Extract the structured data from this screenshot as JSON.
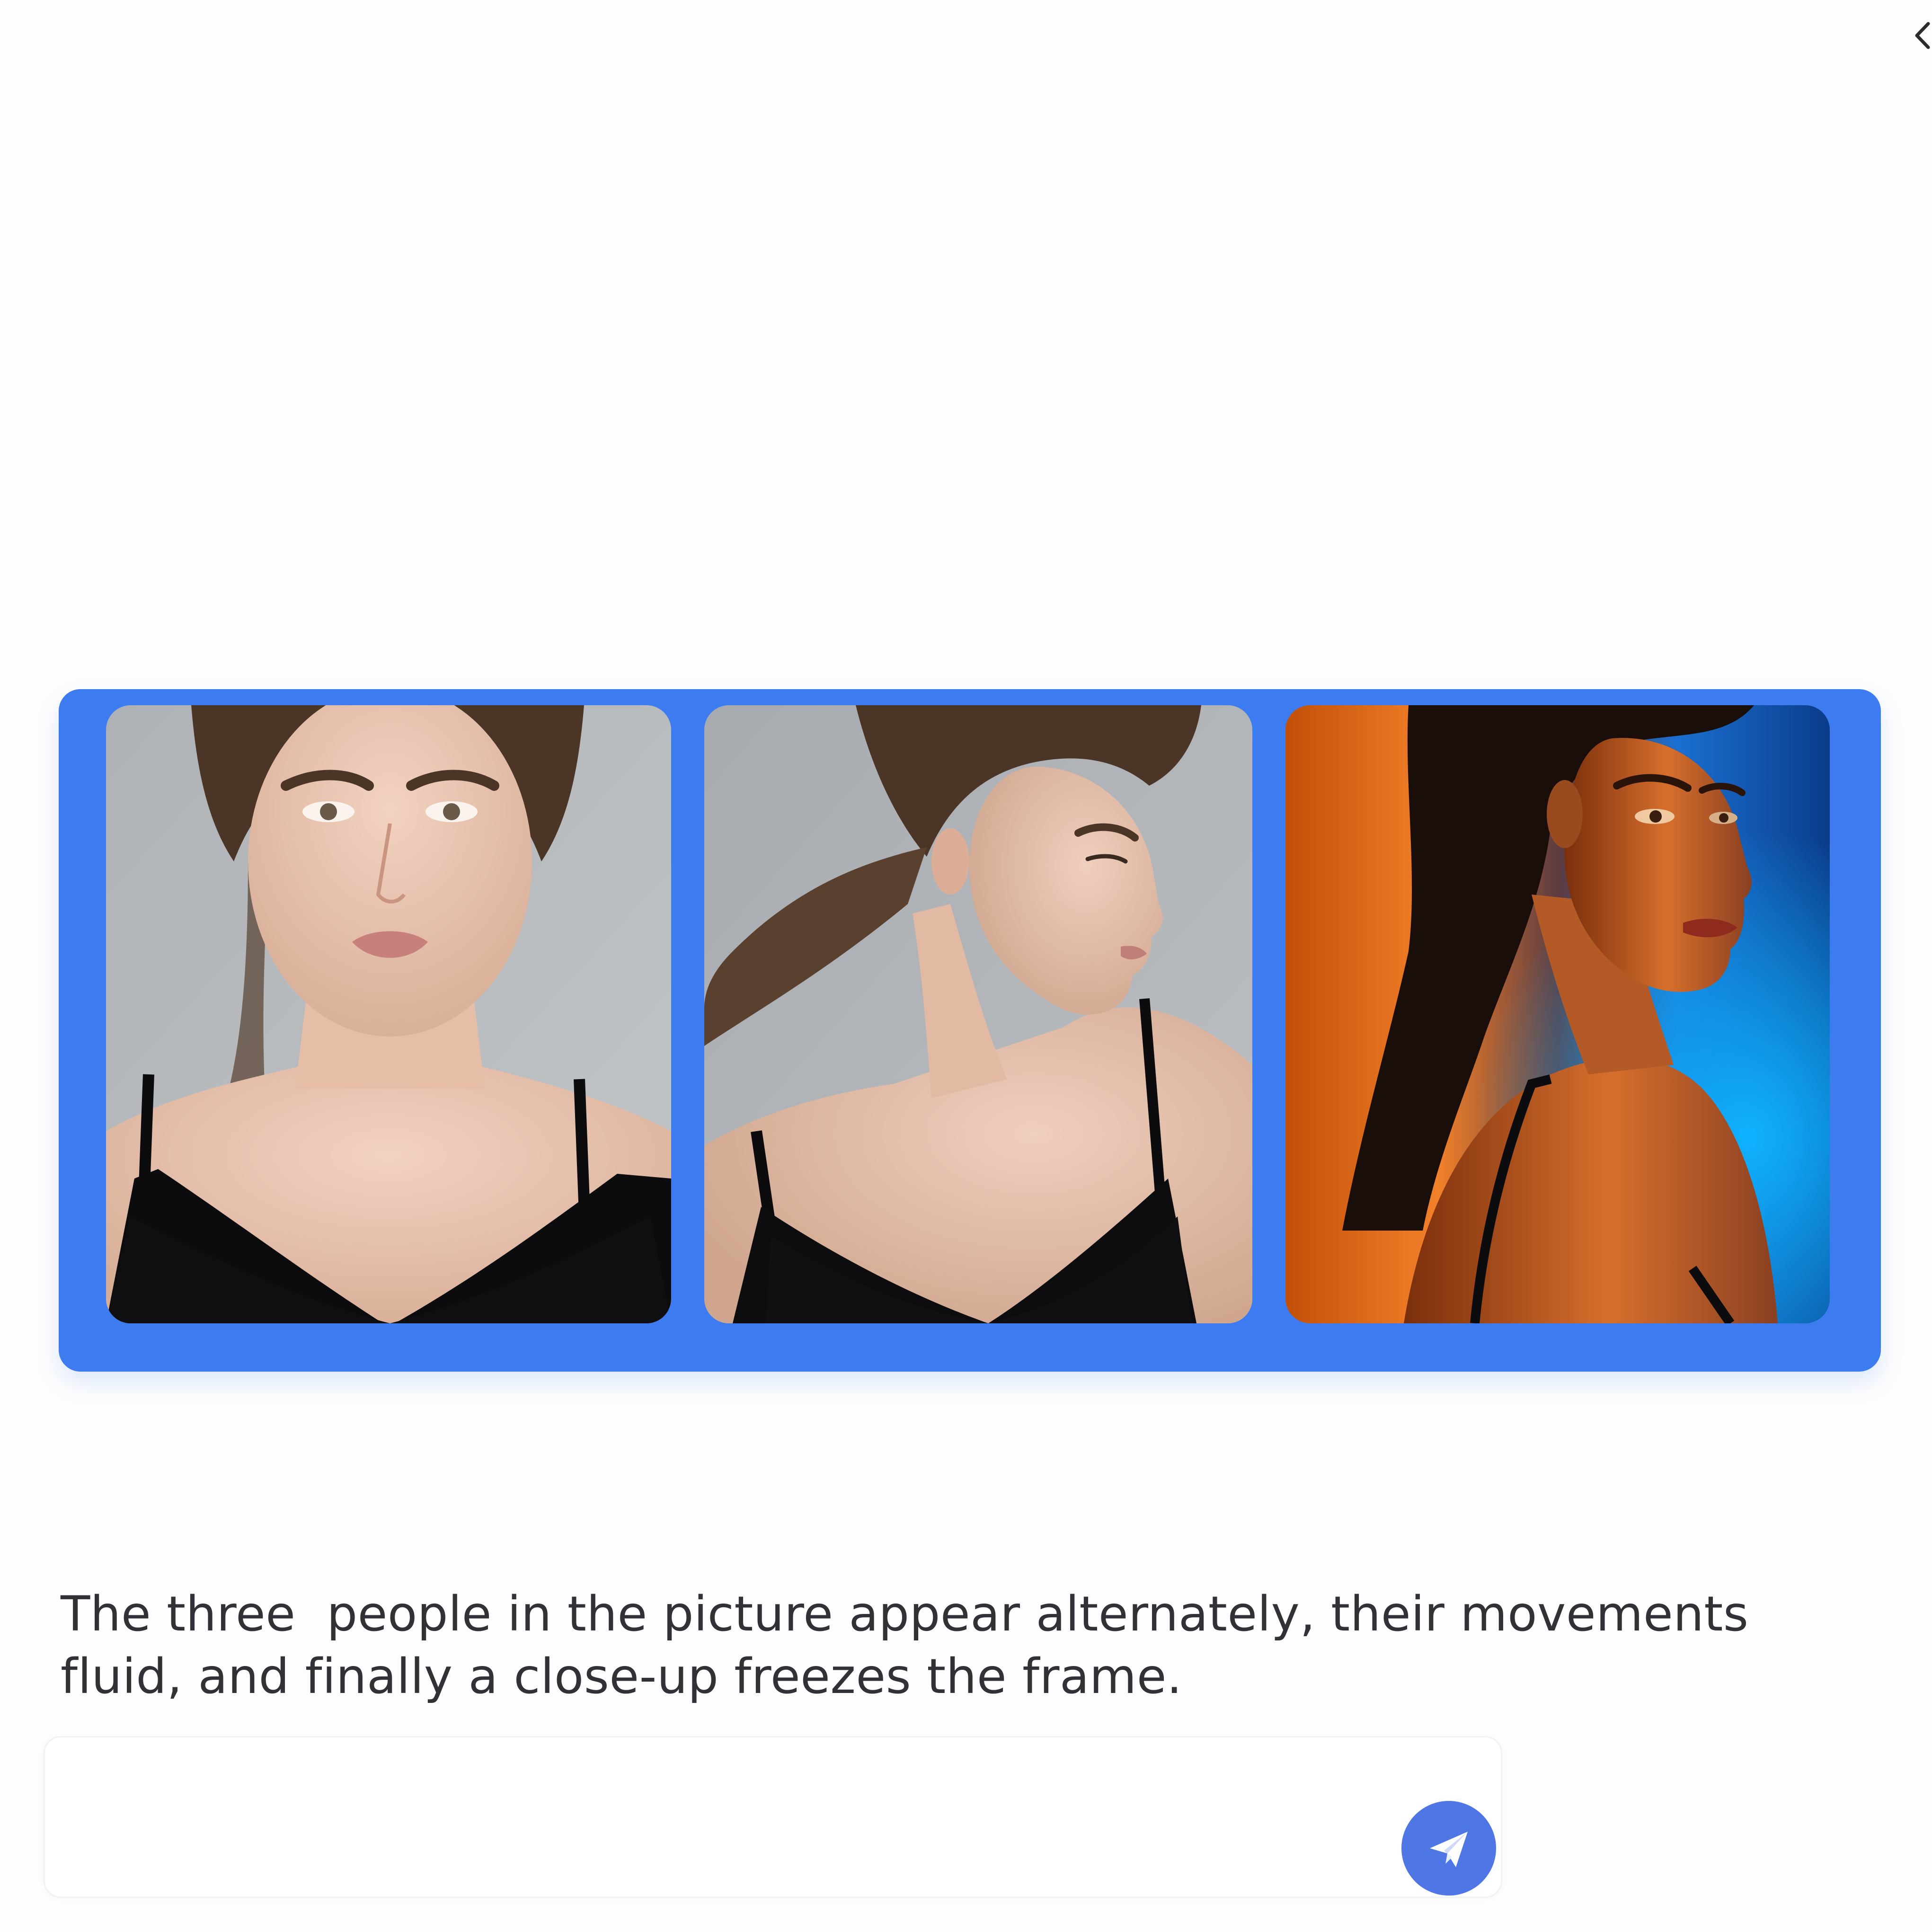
{
  "caption": {
    "line1": "The three  people in the picture appear alternately, their movements",
    "line2": "fluid, and finally a close-up freezes the frame."
  },
  "prompt": {
    "value": "",
    "placeholder": ""
  },
  "icons": {
    "collapse": "chevron-left-icon",
    "send": "paper-plane-icon"
  },
  "colors": {
    "frame": "#3d7cf0",
    "send_button": "#4f76e5",
    "caption_text": "#303237",
    "background": "#fdfdfd"
  }
}
